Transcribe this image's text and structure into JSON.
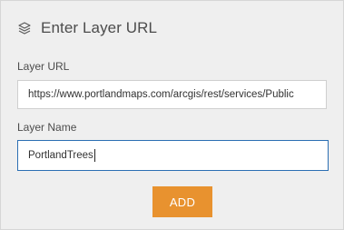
{
  "panel": {
    "title": "Enter Layer URL",
    "title_icon": "layers-icon"
  },
  "form": {
    "url_label": "Layer URL",
    "url_value": "https://www.portlandmaps.com/arcgis/rest/services/Public",
    "name_label": "Layer Name",
    "name_value": "PortlandTrees",
    "add_label": "ADD"
  },
  "colors": {
    "accent_button": "#e8922f",
    "focus_border": "#2c6fb3",
    "panel_background": "#efefef"
  }
}
